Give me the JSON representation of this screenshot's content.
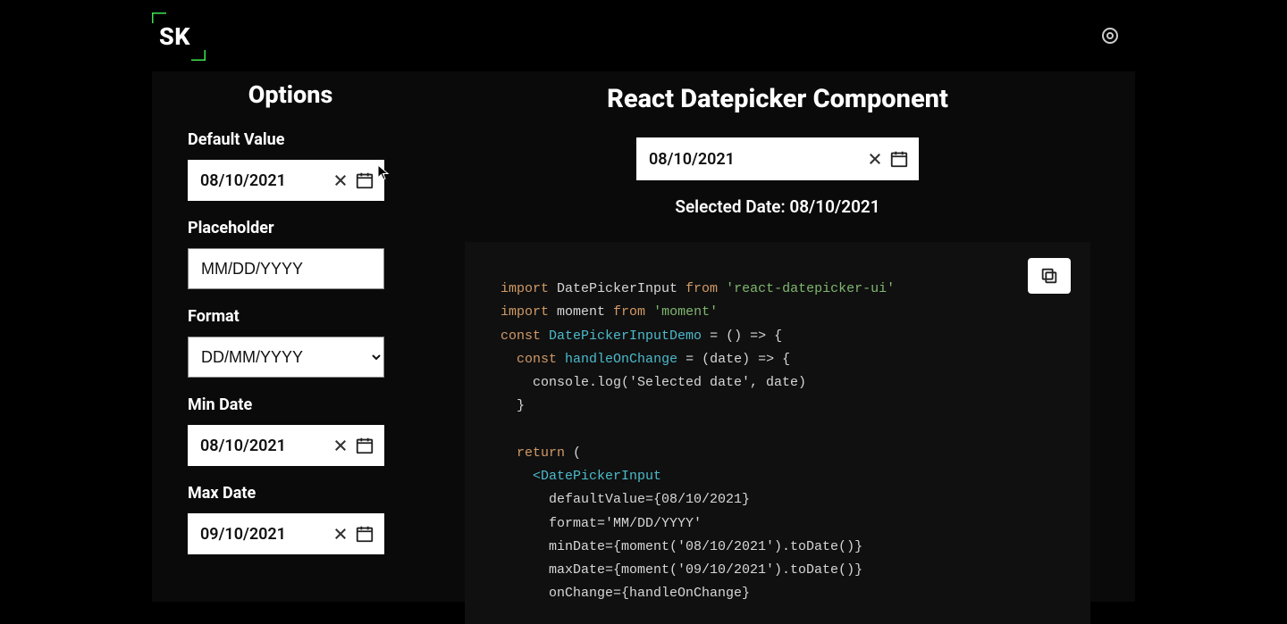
{
  "logo": {
    "text": "SK"
  },
  "options": {
    "heading": "Options",
    "default_value": {
      "label": "Default Value",
      "value": "08/10/2021"
    },
    "placeholder": {
      "label": "Placeholder",
      "value": "MM/DD/YYYY"
    },
    "format": {
      "label": "Format",
      "value": "DD/MM/YYYY"
    },
    "min_date": {
      "label": "Min Date",
      "value": "08/10/2021"
    },
    "max_date": {
      "label": "Max Date",
      "value": "09/10/2021"
    }
  },
  "main": {
    "title": "React Datepicker Component",
    "demo_value": "08/10/2021",
    "selected_prefix": "Selected Date: ",
    "selected_value": "08/10/2021"
  },
  "code": {
    "lines": [
      {
        "parts": [
          [
            "kw",
            "import"
          ],
          [
            "",
            " DatePickerInput "
          ],
          [
            "kw",
            "from"
          ],
          [
            "",
            " "
          ],
          [
            "str",
            "'react-datepicker-ui'"
          ]
        ]
      },
      {
        "parts": [
          [
            "kw",
            "import"
          ],
          [
            "",
            " moment "
          ],
          [
            "kw",
            "from"
          ],
          [
            "",
            " "
          ],
          [
            "str",
            "'moment'"
          ]
        ]
      },
      {
        "parts": [
          [
            "kw",
            "const"
          ],
          [
            "",
            " "
          ],
          [
            "fn",
            "DatePickerInputDemo"
          ],
          [
            "",
            " = () => {"
          ]
        ]
      },
      {
        "parts": [
          [
            "",
            "  "
          ],
          [
            "kw",
            "const"
          ],
          [
            "",
            " "
          ],
          [
            "fn",
            "handleOnChange"
          ],
          [
            "",
            " = (date) => {"
          ]
        ]
      },
      {
        "parts": [
          [
            "",
            "    console.log('Selected date', date)"
          ]
        ]
      },
      {
        "parts": [
          [
            "",
            "  }"
          ]
        ]
      },
      {
        "parts": [
          [
            "",
            ""
          ]
        ]
      },
      {
        "parts": [
          [
            "",
            "  "
          ],
          [
            "kw",
            "return"
          ],
          [
            "",
            " ("
          ]
        ]
      },
      {
        "parts": [
          [
            "",
            "    "
          ],
          [
            "tag",
            "<DatePickerInput"
          ]
        ]
      },
      {
        "parts": [
          [
            "",
            "      defaultValue={08/10/2021}"
          ]
        ]
      },
      {
        "parts": [
          [
            "",
            "      format='MM/DD/YYYY'"
          ]
        ]
      },
      {
        "parts": [
          [
            "",
            "      minDate={moment('08/10/2021').toDate()}"
          ]
        ]
      },
      {
        "parts": [
          [
            "",
            "      maxDate={moment('09/10/2021').toDate()}"
          ]
        ]
      },
      {
        "parts": [
          [
            "",
            "      onChange={handleOnChange}"
          ]
        ]
      }
    ]
  }
}
